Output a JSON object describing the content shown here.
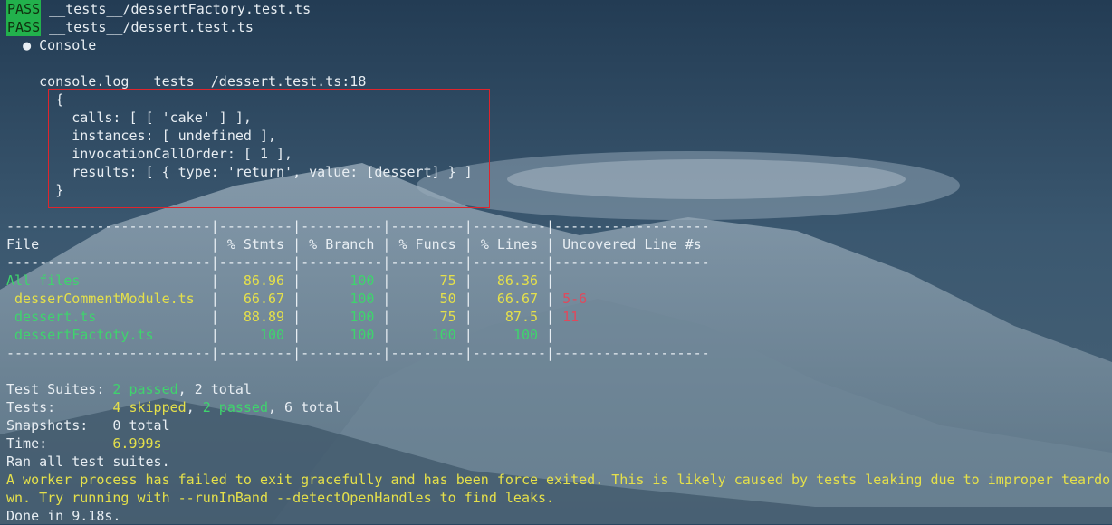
{
  "header": {
    "pass_badge": "PASS",
    "suite_1": "__tests__/dessertFactory.test.ts",
    "suite_2": "__tests__/dessert.test.ts",
    "console_title": "● Console"
  },
  "console_log": {
    "source": "console.log __tests__/dessert.test.ts:18",
    "open_brace": "{",
    "calls": "calls: [ [ 'cake' ] ],",
    "instances": "instances: [ undefined ],",
    "invocation": "invocationCallOrder: [ 1 ],",
    "results": "results: [ { type: 'return', value: [dessert] } ]",
    "close_brace": "}"
  },
  "coverage": {
    "sep_top": "-------------------------|---------|----------|---------|---------|-------------------",
    "header": {
      "file": "File",
      "stmts": "% Stmts",
      "branch": "% Branch",
      "funcs": "% Funcs",
      "lines": "% Lines",
      "uncovered": "Uncovered Line #s"
    },
    "sep_mid": "-------------------------|---------|----------|---------|---------|-------------------",
    "rows": [
      {
        "file": "All files",
        "stmts": "86.96",
        "branch": "100",
        "funcs": "75",
        "lines": "86.36",
        "uncovered": ""
      },
      {
        "file": "desserCommentModule.ts",
        "stmts": "66.67",
        "branch": "100",
        "funcs": "50",
        "lines": "66.67",
        "uncovered": "5-6"
      },
      {
        "file": "dessert.ts",
        "stmts": "88.89",
        "branch": "100",
        "funcs": "75",
        "lines": "87.5",
        "uncovered": "11"
      },
      {
        "file": "dessertFactoty.ts",
        "stmts": "100",
        "branch": "100",
        "funcs": "100",
        "lines": "100",
        "uncovered": ""
      }
    ],
    "sep_bottom": "-------------------------|---------|----------|---------|---------|-------------------"
  },
  "summary": {
    "suites_label": "Test Suites: ",
    "suites_passed": "2 passed",
    "suites_total": ", 2 total",
    "tests_label": "Tests:       ",
    "tests_skipped": "4 skipped",
    "tests_sep": ", ",
    "tests_passed": "2 passed",
    "tests_total": ", 6 total",
    "snapshots_label": "Snapshots:   ",
    "snapshots_value": "0 total",
    "time_label": "Time:        ",
    "time_value": "6.999s",
    "ran_all": "Ran all test suites.",
    "warning_a": "A worker process has failed to exit gracefully and has been force exited.",
    "warning_b": " This is likely caused by tests leaking due to improper teardo",
    "warning_c": "wn. Try running with --runInBand --detectOpenHandles to find leaks.",
    "done": "Done in 9.18s."
  },
  "colors": {
    "pass_bg": "#22b14c",
    "green": "#3fd46d",
    "yellow": "#e5e04a",
    "red": "#e0495c",
    "highlight_border": "#e0242c"
  }
}
